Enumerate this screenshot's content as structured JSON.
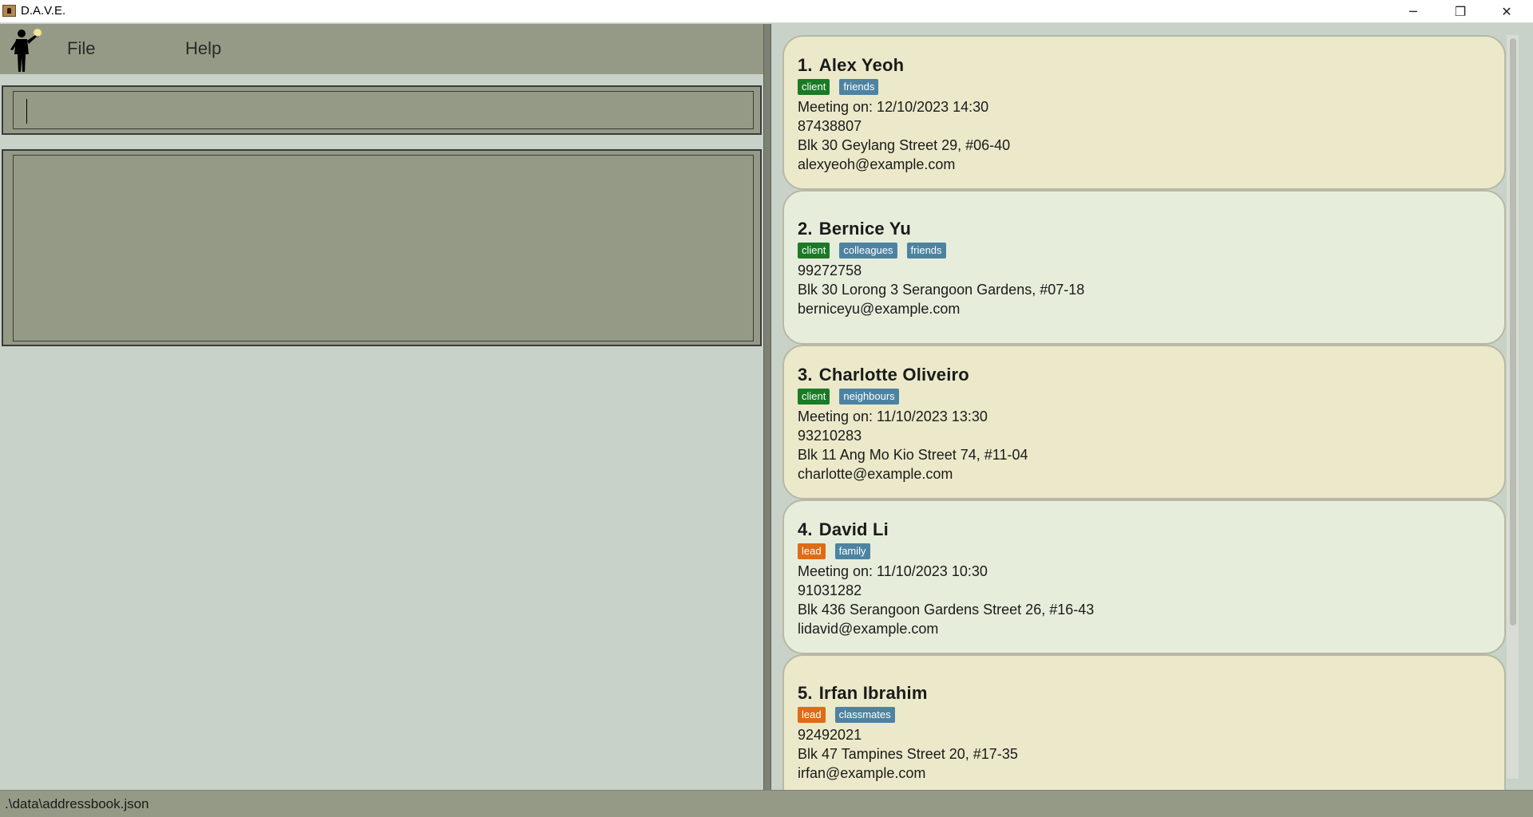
{
  "window": {
    "title": "D.A.V.E.",
    "minimize_glyph": "─",
    "restore_glyph": "❐",
    "close_glyph": "✕"
  },
  "menu": {
    "file_label": "File",
    "help_label": "Help"
  },
  "command": {
    "value": "",
    "placeholder": ""
  },
  "result": {
    "text": ""
  },
  "persons": [
    {
      "index": "1.",
      "name": "Alex Yeoh",
      "tags": [
        {
          "label": "client",
          "kind": "client"
        },
        {
          "label": "friends",
          "kind": "other"
        }
      ],
      "meeting": "Meeting on: 12/10/2023 14:30",
      "phone": "87438807",
      "address": "Blk 30 Geylang Street 29, #06-40",
      "email": "alexyeoh@example.com"
    },
    {
      "index": "2.",
      "name": "Bernice Yu",
      "tags": [
        {
          "label": "client",
          "kind": "client"
        },
        {
          "label": "colleagues",
          "kind": "other"
        },
        {
          "label": "friends",
          "kind": "other"
        }
      ],
      "meeting": "",
      "phone": "99272758",
      "address": "Blk 30 Lorong 3 Serangoon Gardens, #07-18",
      "email": "berniceyu@example.com"
    },
    {
      "index": "3.",
      "name": "Charlotte Oliveiro",
      "tags": [
        {
          "label": "client",
          "kind": "client"
        },
        {
          "label": "neighbours",
          "kind": "other"
        }
      ],
      "meeting": "Meeting on: 11/10/2023 13:30",
      "phone": "93210283",
      "address": "Blk 11 Ang Mo Kio Street 74, #11-04",
      "email": "charlotte@example.com"
    },
    {
      "index": "4.",
      "name": "David Li",
      "tags": [
        {
          "label": "lead",
          "kind": "lead"
        },
        {
          "label": "family",
          "kind": "other"
        }
      ],
      "meeting": "Meeting on: 11/10/2023 10:30",
      "phone": "91031282",
      "address": "Blk 436 Serangoon Gardens Street 26, #16-43",
      "email": "lidavid@example.com"
    },
    {
      "index": "5.",
      "name": "Irfan Ibrahim",
      "tags": [
        {
          "label": "lead",
          "kind": "lead"
        },
        {
          "label": "classmates",
          "kind": "other"
        }
      ],
      "meeting": "",
      "phone": "92492021",
      "address": "Blk 47 Tampines Street 20, #17-35",
      "email": "irfan@example.com"
    }
  ],
  "status": {
    "file_path": ".\\data\\addressbook.json"
  },
  "colors": {
    "menubar_bg": "#959a86",
    "pane_bg": "#c8d2c8",
    "card_odd": "#ebe9ca",
    "card_even": "#e6eedb",
    "tag_client": "#1a7a26",
    "tag_lead": "#e06b15",
    "tag_other": "#4d83a1"
  },
  "icons": {
    "app": "address-book-icon",
    "logo": "businessman-lightbulb-icon"
  }
}
